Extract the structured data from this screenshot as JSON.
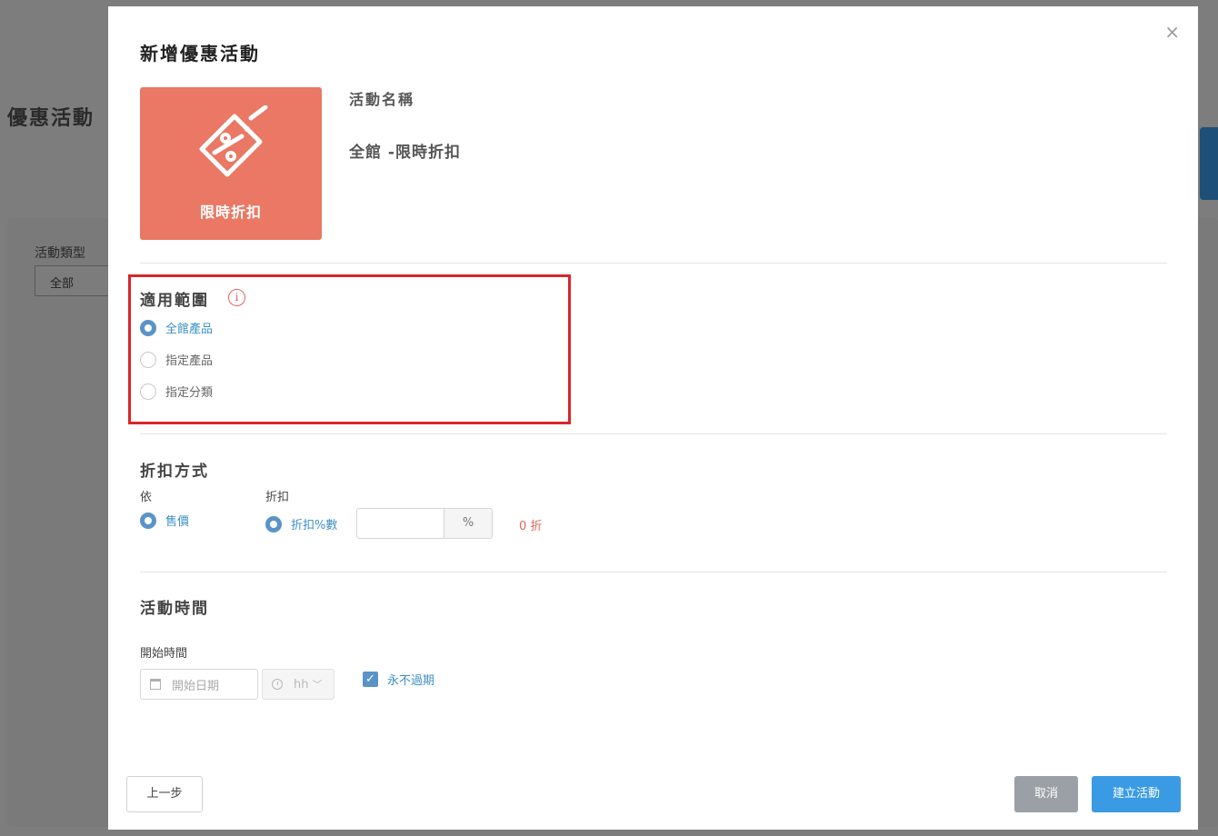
{
  "background": {
    "title": "優惠活動",
    "filter_label": "活動類型",
    "filter_value": "全部"
  },
  "modal": {
    "title": "新增優惠活動",
    "close_icon": "×",
    "promo_card": {
      "icon": "discount-tag-icon",
      "label": "限時折扣",
      "color": "#ea7864"
    },
    "name_label": "活動名稱",
    "name_value": "全館 -限時折扣"
  },
  "scope": {
    "title": "適用範圍",
    "info_icon": "i",
    "options": [
      {
        "label": "全館產品",
        "checked": true
      },
      {
        "label": "指定產品",
        "checked": false
      },
      {
        "label": "指定分類",
        "checked": false
      }
    ]
  },
  "discount": {
    "title": "折扣方式",
    "basis_label": "依",
    "basis_option": "售價",
    "discount_label": "折扣",
    "discount_option": "折扣%數",
    "input_value": "",
    "unit": "%",
    "result": "0 折"
  },
  "schedule": {
    "title": "活動時間",
    "start_label": "開始時間",
    "date_placeholder": "開始日期",
    "time_placeholder": "hh",
    "never_expire_label": "永不過期",
    "never_expire_checked": true
  },
  "footer": {
    "prev_label": "上一步",
    "cancel_label": "取消",
    "create_label": "建立活動"
  },
  "colors": {
    "accent": "#3a9be4",
    "radio": "#5b93c9",
    "highlight": "#d9262c",
    "warning": "#e0655a"
  }
}
